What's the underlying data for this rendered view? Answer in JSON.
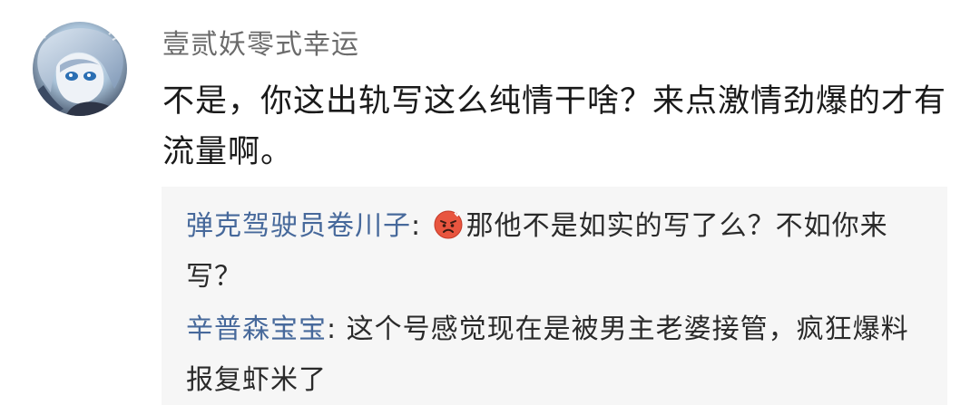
{
  "comment": {
    "username": "壹贰妖零式幸运",
    "text": "不是，你这出轨写这么纯情干啥？来点激情劲爆的才有流量啊。"
  },
  "replies": [
    {
      "author": "弹克驾驶员卷川子",
      "separator": ": ",
      "emoji": "angry-face-icon",
      "text": "那他不是如实的写了么？不如你来写？"
    },
    {
      "author": "辛普森宝宝",
      "separator": ": ",
      "text": "这个号感觉现在是被男主老婆接管，疯狂爆料报复虾米了"
    }
  ],
  "colors": {
    "username": "#6b6b6b",
    "reply_author": "#47699b",
    "reply_background": "#f6f6f6",
    "emoji": "#e8553f"
  }
}
